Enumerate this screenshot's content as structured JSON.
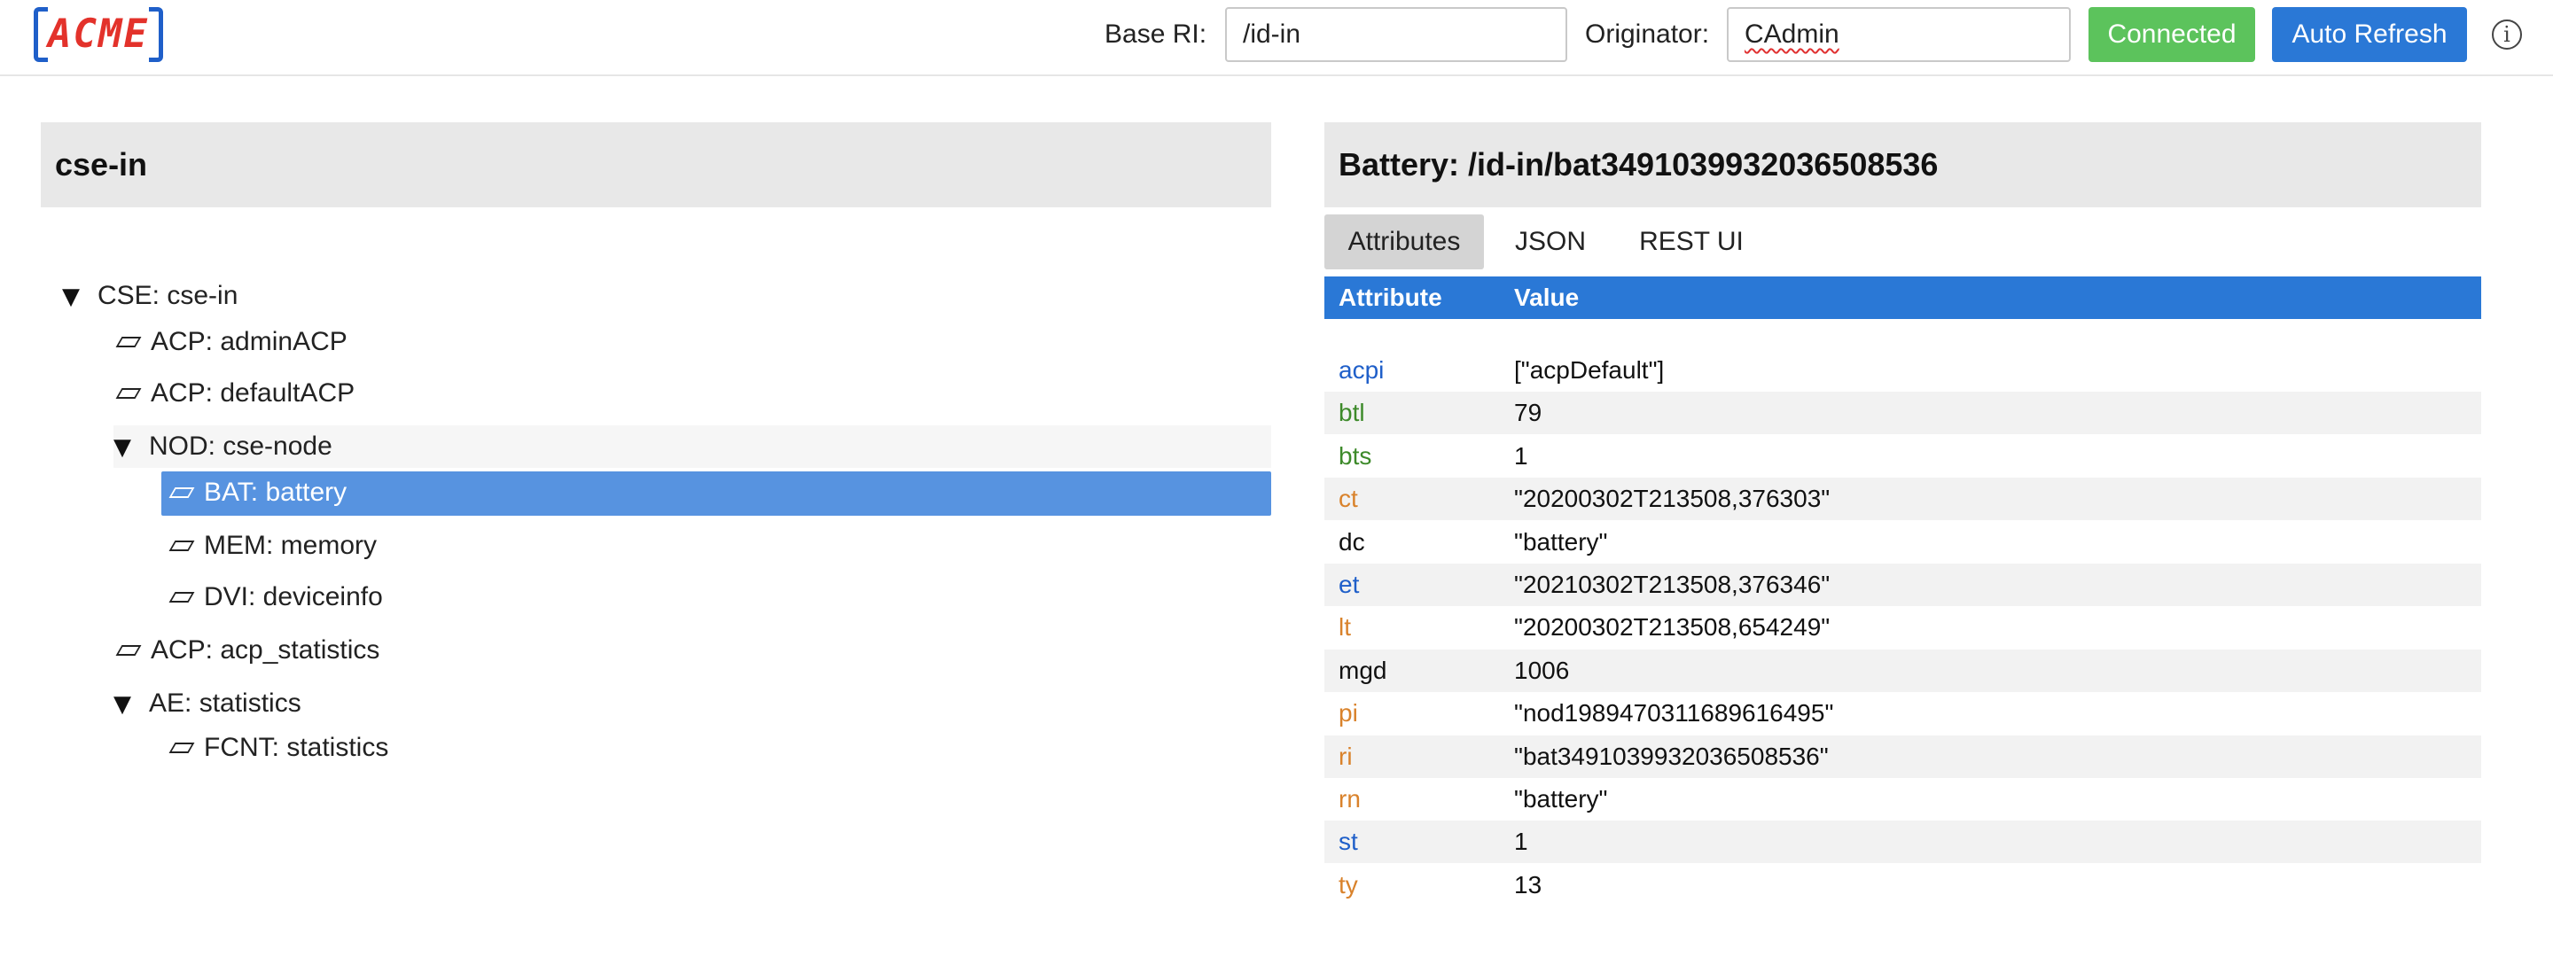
{
  "logo": {
    "text": "ACME"
  },
  "toolbar": {
    "base_ri_label": "Base RI:",
    "base_ri_value": "/id-in",
    "originator_label": "Originator:",
    "originator_value": "CAdmin",
    "connected_label": "Connected",
    "auto_refresh_label": "Auto Refresh",
    "info_icon": "i"
  },
  "colors": {
    "connected": "#5cc35c",
    "accent_blue": "#2a78d6",
    "selected_row": "#5793e0",
    "key_blue": "#1f5fc9",
    "key_green": "#3d8a2a",
    "key_orange": "#d9822b"
  },
  "tree": {
    "title": "cse-in",
    "nodes": [
      {
        "label": "CSE: cse-in",
        "icon": "expanded-triangle-icon"
      },
      {
        "label": "ACP: adminACP",
        "icon": "resource-leaf-icon"
      },
      {
        "label": "ACP: defaultACP",
        "icon": "resource-leaf-icon"
      },
      {
        "label": "NOD: cse-node",
        "icon": "expanded-triangle-icon"
      },
      {
        "label": "BAT: battery",
        "icon": "resource-leaf-icon",
        "selected": true
      },
      {
        "label": "MEM: memory",
        "icon": "resource-leaf-icon"
      },
      {
        "label": "DVI: deviceinfo",
        "icon": "resource-leaf-icon"
      },
      {
        "label": "ACP: acp_statistics",
        "icon": "resource-leaf-icon"
      },
      {
        "label": "AE: statistics",
        "icon": "expanded-triangle-icon"
      },
      {
        "label": "FCNT: statistics",
        "icon": "resource-leaf-icon"
      }
    ]
  },
  "detail": {
    "title": "Battery: /id-in/bat3491039932036508536",
    "tabs": [
      "Attributes",
      "JSON",
      "REST UI"
    ],
    "active_tab": "Attributes",
    "columns": [
      "Attribute",
      "Value"
    ],
    "rows": [
      {
        "key": "acpi",
        "value": "[\"acpDefault\"]",
        "key_color": "blue"
      },
      {
        "key": "btl",
        "value": "79",
        "key_color": "green"
      },
      {
        "key": "bts",
        "value": "1",
        "key_color": "green"
      },
      {
        "key": "ct",
        "value": "\"20200302T213508,376303\"",
        "key_color": "orange"
      },
      {
        "key": "dc",
        "value": "\"battery\"",
        "key_color": "black"
      },
      {
        "key": "et",
        "value": "\"20210302T213508,376346\"",
        "key_color": "blue"
      },
      {
        "key": "lt",
        "value": "\"20200302T213508,654249\"",
        "key_color": "orange"
      },
      {
        "key": "mgd",
        "value": "1006",
        "key_color": "black"
      },
      {
        "key": "pi",
        "value": "\"nod1989470311689616495\"",
        "key_color": "orange"
      },
      {
        "key": "ri",
        "value": "\"bat3491039932036508536\"",
        "key_color": "orange"
      },
      {
        "key": "rn",
        "value": "\"battery\"",
        "key_color": "orange"
      },
      {
        "key": "st",
        "value": "1",
        "key_color": "blue"
      },
      {
        "key": "ty",
        "value": "13",
        "key_color": "orange"
      }
    ]
  }
}
